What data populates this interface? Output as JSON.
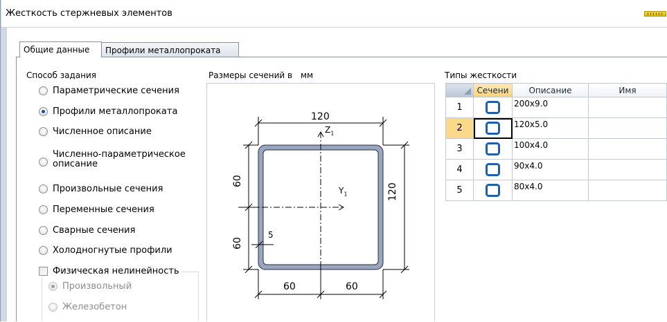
{
  "window": {
    "title": "Жесткость стержневых элементов"
  },
  "tabs": [
    {
      "label": "Общие данные",
      "active": true
    },
    {
      "label": "Профили металлопроката",
      "active": false
    }
  ],
  "method_group": {
    "label": "Способ задания",
    "options": [
      {
        "label": "Параметрические сечения",
        "checked": false
      },
      {
        "label": "Профили металлопроката",
        "checked": true
      },
      {
        "label": "Численное описание",
        "checked": false
      },
      {
        "label_line1": "Численно-параметрическое",
        "label_line2": "описание",
        "checked": false
      },
      {
        "label": "Произвольные сечения",
        "checked": false
      },
      {
        "label": "Переменные сечения",
        "checked": false
      },
      {
        "label": "Сварные сечения",
        "checked": false
      },
      {
        "label": "Холодногнутые профили",
        "checked": false
      }
    ],
    "nonlinear": {
      "label": "Физическая нелинейность",
      "checked": false,
      "options": [
        {
          "label": "Произвольный",
          "checked": true,
          "enabled": false
        },
        {
          "label": "Железобетон",
          "checked": false,
          "enabled": false
        }
      ]
    }
  },
  "section_dims": {
    "label": "Размеры сечений в",
    "unit": "мм",
    "dims": {
      "top": "120",
      "right": "120",
      "left_upper": "60",
      "left_lower": "60",
      "bottom_left": "60",
      "bottom_right": "60",
      "thickness": "5",
      "axis_z": "Z",
      "axis_z_sub": "1",
      "axis_y": "Y",
      "axis_y_sub": "1"
    }
  },
  "stiffness_types": {
    "label": "Типы жесткости",
    "columns": [
      "Сечени",
      "Описание",
      "Имя"
    ],
    "rows": [
      {
        "num": "1",
        "description": "200x9.0",
        "name": "",
        "selected": false
      },
      {
        "num": "2",
        "description": "120x5.0",
        "name": "",
        "selected": true
      },
      {
        "num": "3",
        "description": "100x4.0",
        "name": "",
        "selected": false
      },
      {
        "num": "4",
        "description": "90x4.0",
        "name": "",
        "selected": false
      },
      {
        "num": "5",
        "description": "80x4.0",
        "name": "",
        "selected": false
      }
    ]
  },
  "colors": {
    "accent_selected": "#fbd98a",
    "section_icon": "#1f5ea8",
    "profile_fill": "#9aa6bf"
  },
  "icons": {
    "app": "ruler-icon",
    "section": "square-tube-icon"
  }
}
